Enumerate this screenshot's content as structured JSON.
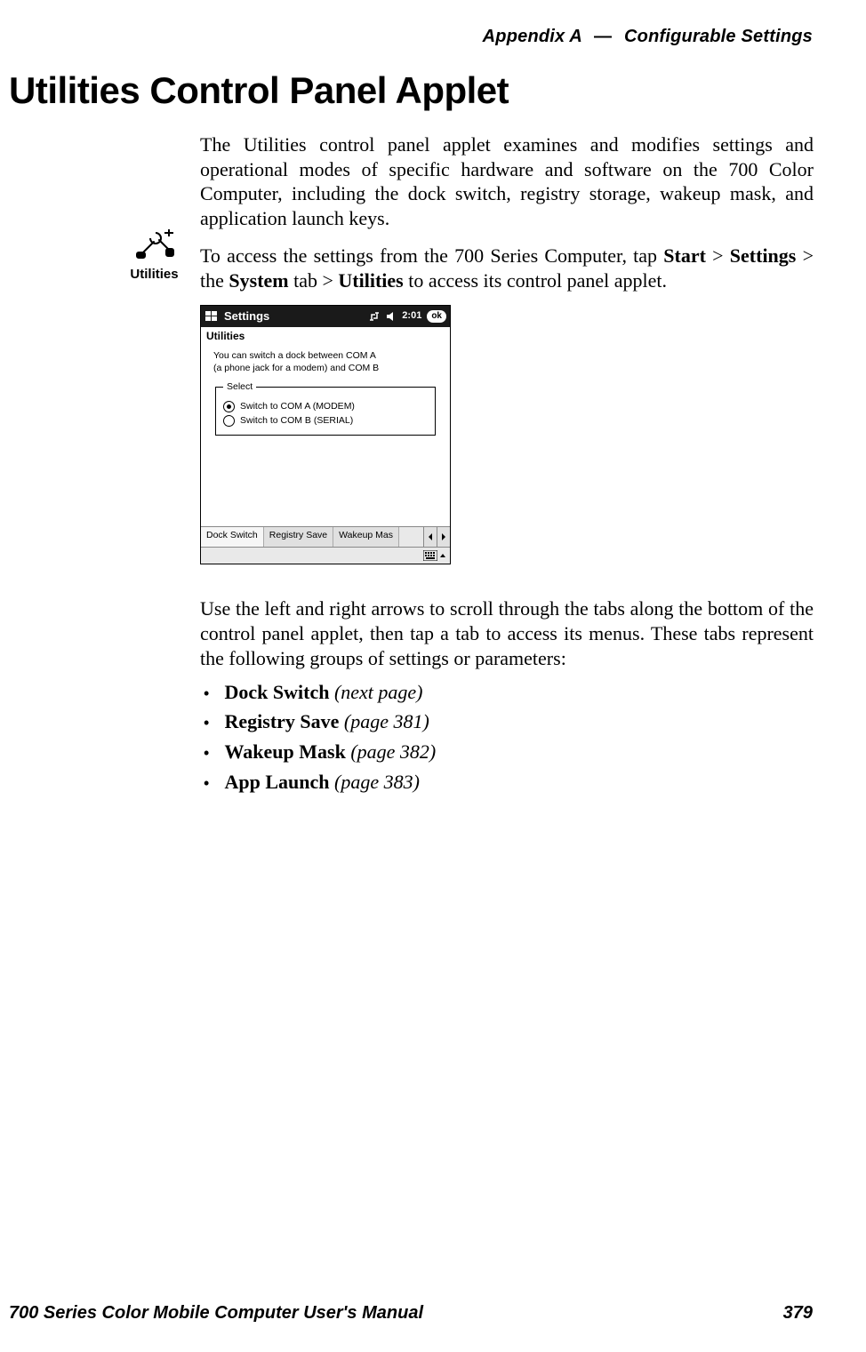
{
  "header": {
    "appendix": "Appendix A",
    "separator": "—",
    "section": "Configurable Settings"
  },
  "title": "Utilities Control Panel Applet",
  "intro": "The Utilities control panel applet examines and modifies settings and operational modes of specific hardware and software on the 700 Color Computer, including the dock switch, registry storage, wakeup mask, and application launch keys.",
  "access": {
    "prefix": "To access the settings from the 700 Series Computer, tap ",
    "start": "Start",
    "gt1": " > ",
    "settings": "Settings",
    "gt2": " > the ",
    "system": "System",
    "tab_gt": " tab > ",
    "utilities": "Utilities",
    "suffix": " to access its control panel applet."
  },
  "icon": {
    "label": "Utilities"
  },
  "screenshot": {
    "titlebar": {
      "title": "Settings",
      "time": "2:01",
      "ok": "ok"
    },
    "subhead": "Utilities",
    "desc_line1": "You can switch a dock between COM A",
    "desc_line2": "(a phone jack for a modem) and COM B",
    "legend": "Select",
    "radio_a": "Switch to COM A (MODEM)",
    "radio_b": "Switch to COM B (SERIAL)",
    "tabs": {
      "dock": "Dock Switch",
      "registry": "Registry Save",
      "wakeup": "Wakeup Mas"
    }
  },
  "after_para": "Use the left and right arrows to scroll through the tabs along the bottom of the control panel applet, then tap a tab to access its menus. These tabs represent the following groups of settings or parameters:",
  "groups": [
    {
      "name": "Dock Switch",
      "ref": "(next page)"
    },
    {
      "name": "Registry Save",
      "ref": "(page 381)"
    },
    {
      "name": "Wakeup Mask",
      "ref": "(page 382)"
    },
    {
      "name": "App Launch",
      "ref": "(page 383)"
    }
  ],
  "footer": {
    "manual": "700 Series Color Mobile Computer User's Manual",
    "page": "379"
  }
}
